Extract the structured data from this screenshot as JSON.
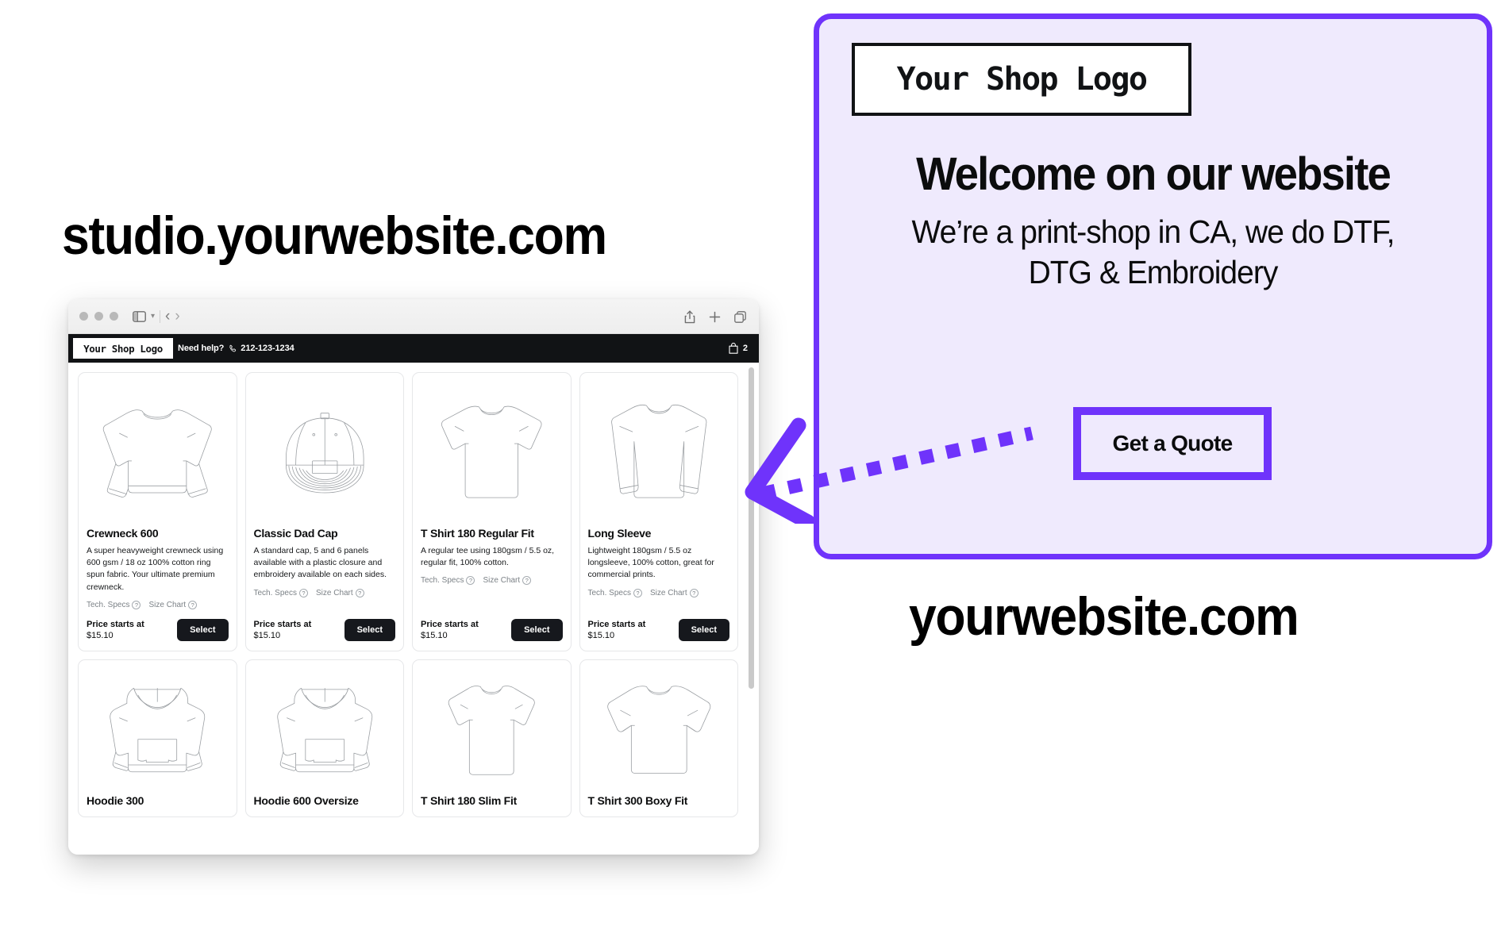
{
  "headings": {
    "studio_url": "studio.yourwebsite.com",
    "site_url": "yourwebsite.com"
  },
  "browser": {
    "traffic_lights": [
      "close-dot",
      "minimize-dot",
      "maximize-dot"
    ],
    "sidebar_icon": "sidebar-icon",
    "sidebar_caret": "chevron-down-icon",
    "back_glyph": "‹",
    "forward_glyph": "›",
    "share_icon": "share-icon",
    "new_tab_icon": "plus-icon",
    "tabs_icon": "tab-overview-icon"
  },
  "site_header": {
    "logo": "Your Shop Logo",
    "help_text": "Need help?",
    "phone": "212-123-1234",
    "phone_icon": "phone-icon",
    "cart_icon": "shopping-bag-icon",
    "cart_count": "2"
  },
  "labels": {
    "tech_specs": "Tech. Specs",
    "size_chart": "Size Chart",
    "price_starts_at": "Price starts at",
    "select": "Select",
    "help_glyph": "?"
  },
  "products": [
    {
      "id": "crewneck-600",
      "art": "crewneck",
      "title": "Crewneck 600",
      "desc": "A super heavyweight crewneck using 600 gsm / 18 oz 100% cotton ring spun fabric. Your ultimate premium crewneck.",
      "price": "$15.10"
    },
    {
      "id": "classic-dad-cap",
      "art": "cap",
      "title": "Classic Dad Cap",
      "desc": "A standard cap, 5 and 6 panels available with a plastic closure and embroidery available on each sides.",
      "price": "$15.10"
    },
    {
      "id": "t-shirt-180-regular-fit",
      "art": "tshirt",
      "title": "T Shirt 180 Regular Fit",
      "desc": "A regular tee using 180gsm / 5.5 oz, regular fit, 100% cotton.",
      "price": "$15.10"
    },
    {
      "id": "long-sleeve",
      "art": "longsleeve",
      "title": "Long Sleeve",
      "desc": "Lightweight 180gsm / 5.5 oz longsleeve, 100% cotton, great for commercial prints.",
      "price": "$15.10"
    }
  ],
  "products_row2": [
    {
      "id": "hoodie-300",
      "art": "hoodie",
      "title": "Hoodie 300"
    },
    {
      "id": "hoodie-600-oversize",
      "art": "hoodie",
      "title": "Hoodie 600 Oversize"
    },
    {
      "id": "t-shirt-180-slim-fit",
      "art": "tshirt",
      "title": "T Shirt 180 Slim Fit"
    },
    {
      "id": "t-shirt-300-boxy-fit",
      "art": "boxytee",
      "title": "T Shirt 300 Boxy Fit"
    }
  ],
  "promo": {
    "logo": "Your Shop Logo",
    "title": "Welcome on our website",
    "subtitle": "We’re a print-shop in CA, we do DTF, DTG & Embroidery",
    "cta": "Get a Quote"
  },
  "colors": {
    "accent_purple": "#6F33FB",
    "panel_background": "#EFEAFD",
    "dark_bar": "#111315",
    "button_dark": "#16181D",
    "muted_text": "#7C8287"
  }
}
